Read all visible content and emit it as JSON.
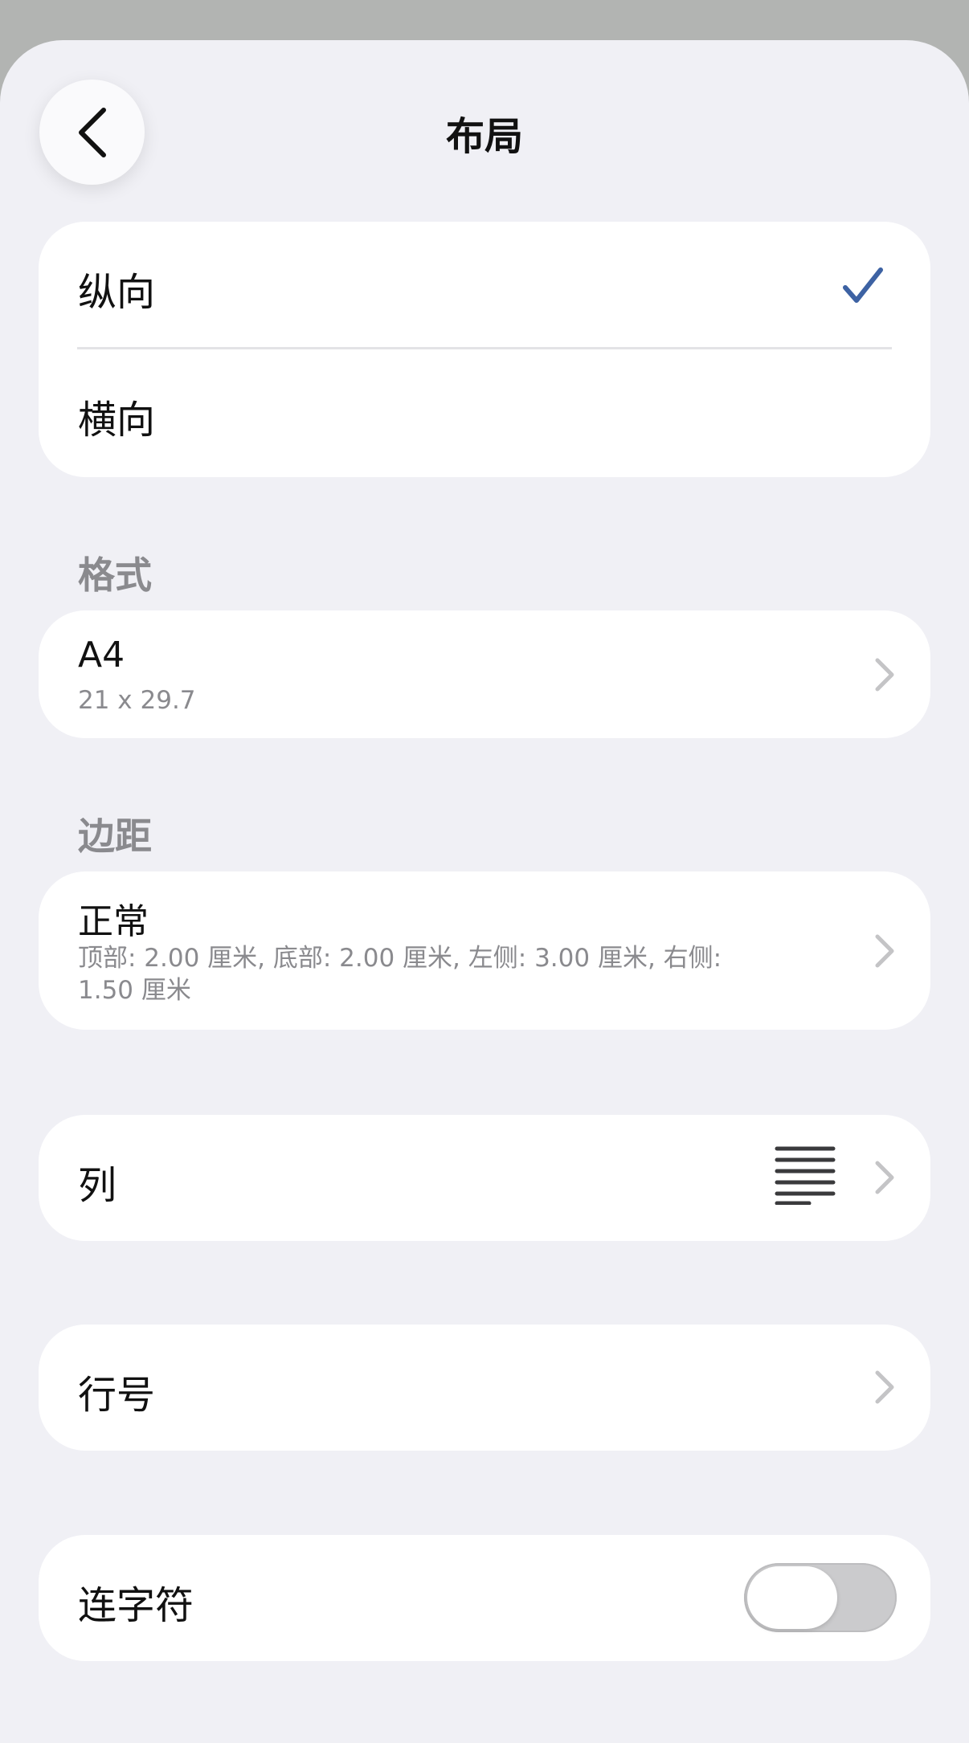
{
  "nav": {
    "title": "布局"
  },
  "orientation": {
    "portrait_label": "纵向",
    "landscape_label": "横向",
    "selected": "纵向"
  },
  "format": {
    "header": "格式",
    "title": "A4",
    "subtitle": "21 x 29.7"
  },
  "margins": {
    "header": "边距",
    "title": "正常",
    "subtitle_line1": "顶部: 2.00 厘米, 底部: 2.00 厘米, 左侧: 3.00 厘米, 右侧:",
    "subtitle_line2": "1.50 厘米"
  },
  "columns": {
    "label": "列"
  },
  "line_numbers": {
    "label": "行号"
  },
  "hyphenation": {
    "label": "连字符",
    "enabled": false
  },
  "colors": {
    "accent": "#3d62a3",
    "chevron": "#c4c4c6",
    "secondary_text": "#8a8a8e"
  },
  "icons": [
    "chevron-left-icon",
    "checkmark-icon",
    "chevron-right-icon",
    "columns-icon"
  ]
}
